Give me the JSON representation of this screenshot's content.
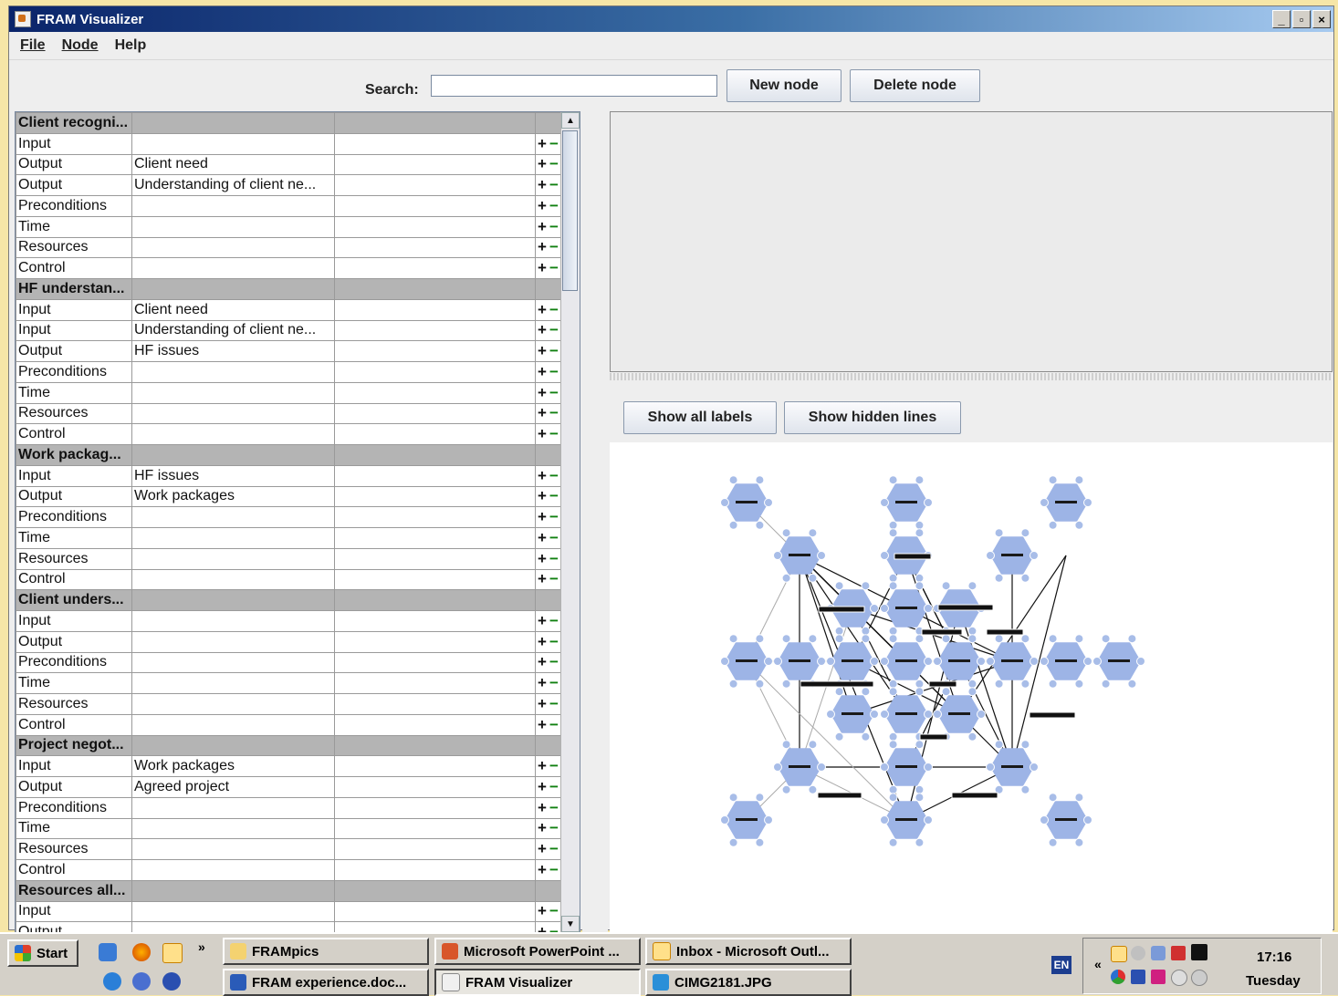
{
  "window": {
    "title": "FRAM Visualizer",
    "minimize": "_",
    "maximize": "▫",
    "close": "×"
  },
  "menu": [
    {
      "label": "File"
    },
    {
      "label": "Node"
    },
    {
      "label": "Help"
    }
  ],
  "toolbar": {
    "search_label": "Search:",
    "search_value": "",
    "new_node": "New node",
    "delete_node": "Delete node"
  },
  "graph_controls": {
    "show_all_labels": "Show all labels",
    "show_hidden_lines": "Show hidden lines"
  },
  "functions": [
    {
      "name": "Client recogni...",
      "aspects": [
        [
          "Input",
          ""
        ],
        [
          "Output",
          "Client need"
        ],
        [
          "Output",
          "Understanding of client ne..."
        ],
        [
          "Preconditions",
          ""
        ],
        [
          "Time",
          ""
        ],
        [
          "Resources",
          ""
        ],
        [
          "Control",
          ""
        ]
      ]
    },
    {
      "name": "HF understan...",
      "aspects": [
        [
          "Input",
          "Client need"
        ],
        [
          "Input",
          "Understanding of client ne..."
        ],
        [
          "Output",
          "HF issues"
        ],
        [
          "Preconditions",
          ""
        ],
        [
          "Time",
          ""
        ],
        [
          "Resources",
          ""
        ],
        [
          "Control",
          ""
        ]
      ]
    },
    {
      "name": "Work packag...",
      "aspects": [
        [
          "Input",
          "HF issues"
        ],
        [
          "Output",
          "Work packages"
        ],
        [
          "Preconditions",
          ""
        ],
        [
          "Time",
          ""
        ],
        [
          "Resources",
          ""
        ],
        [
          "Control",
          ""
        ]
      ]
    },
    {
      "name": "Client unders...",
      "aspects": [
        [
          "Input",
          ""
        ],
        [
          "Output",
          ""
        ],
        [
          "Preconditions",
          ""
        ],
        [
          "Time",
          ""
        ],
        [
          "Resources",
          ""
        ],
        [
          "Control",
          ""
        ]
      ]
    },
    {
      "name": "Project negot...",
      "aspects": [
        [
          "Input",
          "Work packages"
        ],
        [
          "Output",
          "Agreed project"
        ],
        [
          "Preconditions",
          ""
        ],
        [
          "Time",
          ""
        ],
        [
          "Resources",
          ""
        ],
        [
          "Control",
          ""
        ]
      ]
    },
    {
      "name": "Resources all...",
      "aspects": [
        [
          "Input",
          ""
        ],
        [
          "Output",
          ""
        ]
      ]
    }
  ],
  "row_actions": {
    "add": "+",
    "remove": "−"
  },
  "taskbar": {
    "start": "Start",
    "chevron": "»",
    "buttons": [
      {
        "label": "FRAMpics",
        "icon": "folder-icon"
      },
      {
        "label": "Microsoft PowerPoint ...",
        "icon": "powerpoint-icon"
      },
      {
        "label": "Inbox - Microsoft Outl...",
        "icon": "outlook-icon"
      },
      {
        "label": "FRAM experience.doc...",
        "icon": "word-icon"
      },
      {
        "label": "FRAM Visualizer",
        "icon": "java-icon",
        "active": true
      },
      {
        "label": "CIMG2181.JPG",
        "icon": "image-icon"
      }
    ],
    "language": "EN",
    "tray_chevron": "«",
    "clock_time": "17:16",
    "clock_day": "Tuesday"
  }
}
